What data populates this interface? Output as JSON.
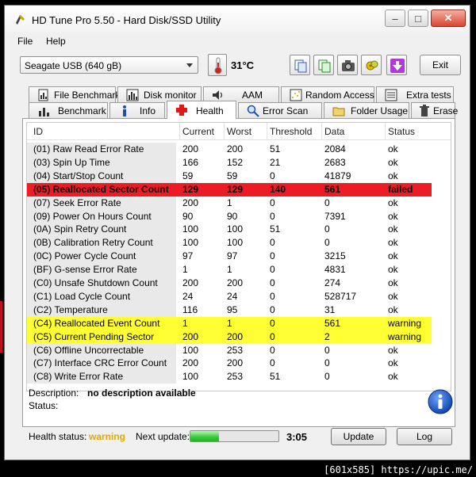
{
  "window": {
    "title": "HD Tune Pro 5.50 - Hard Disk/SSD Utility"
  },
  "menu": {
    "file": "File",
    "help": "Help"
  },
  "toolbar": {
    "drive": "Seagate USB (640 gB)",
    "temperature": "31°C",
    "exit": "Exit"
  },
  "tabs_top": [
    {
      "label": "File Benchmark",
      "icon": "file-benchmark-icon"
    },
    {
      "label": "Disk monitor",
      "icon": "disk-monitor-icon"
    },
    {
      "label": "AAM",
      "icon": "speaker-icon"
    },
    {
      "label": "Random Access",
      "icon": "random-access-icon"
    },
    {
      "label": "Extra tests",
      "icon": "extra-tests-icon"
    }
  ],
  "tabs_bottom": [
    {
      "label": "Benchmark",
      "icon": "benchmark-icon"
    },
    {
      "label": "Info",
      "icon": "info-icon"
    },
    {
      "label": "Health",
      "icon": "health-cross-icon",
      "active": true
    },
    {
      "label": "Error Scan",
      "icon": "magnifier-icon"
    },
    {
      "label": "Folder Usage",
      "icon": "folder-icon"
    },
    {
      "label": "Erase",
      "icon": "trash-icon"
    }
  ],
  "table": {
    "headers": {
      "id": "ID",
      "current": "Current",
      "worst": "Worst",
      "threshold": "Threshold",
      "data": "Data",
      "status": "Status"
    },
    "rows": [
      {
        "id": "(01) Raw Read Error Rate",
        "current": "200",
        "worst": "200",
        "threshold": "51",
        "data": "2084",
        "status": "ok"
      },
      {
        "id": "(03) Spin Up Time",
        "current": "166",
        "worst": "152",
        "threshold": "21",
        "data": "2683",
        "status": "ok"
      },
      {
        "id": "(04) Start/Stop Count",
        "current": "59",
        "worst": "59",
        "threshold": "0",
        "data": "41879",
        "status": "ok"
      },
      {
        "id": "(05) Reallocated Sector Count",
        "current": "129",
        "worst": "129",
        "threshold": "140",
        "data": "561",
        "status": "failed",
        "highlight": "red"
      },
      {
        "id": "(07) Seek Error Rate",
        "current": "200",
        "worst": "1",
        "threshold": "0",
        "data": "0",
        "status": "ok"
      },
      {
        "id": "(09) Power On Hours Count",
        "current": "90",
        "worst": "90",
        "threshold": "0",
        "data": "7391",
        "status": "ok"
      },
      {
        "id": "(0A) Spin Retry Count",
        "current": "100",
        "worst": "100",
        "threshold": "51",
        "data": "0",
        "status": "ok"
      },
      {
        "id": "(0B) Calibration Retry Count",
        "current": "100",
        "worst": "100",
        "threshold": "0",
        "data": "0",
        "status": "ok"
      },
      {
        "id": "(0C) Power Cycle Count",
        "current": "97",
        "worst": "97",
        "threshold": "0",
        "data": "3215",
        "status": "ok"
      },
      {
        "id": "(BF) G-sense Error Rate",
        "current": "1",
        "worst": "1",
        "threshold": "0",
        "data": "4831",
        "status": "ok"
      },
      {
        "id": "(C0) Unsafe Shutdown Count",
        "current": "200",
        "worst": "200",
        "threshold": "0",
        "data": "274",
        "status": "ok"
      },
      {
        "id": "(C1) Load Cycle Count",
        "current": "24",
        "worst": "24",
        "threshold": "0",
        "data": "528717",
        "status": "ok"
      },
      {
        "id": "(C2) Temperature",
        "current": "116",
        "worst": "95",
        "threshold": "0",
        "data": "31",
        "status": "ok"
      },
      {
        "id": "(C4) Reallocated Event Count",
        "current": "1",
        "worst": "1",
        "threshold": "0",
        "data": "561",
        "status": "warning",
        "highlight": "yellow"
      },
      {
        "id": "(C5) Current Pending Sector",
        "current": "200",
        "worst": "200",
        "threshold": "0",
        "data": "2",
        "status": "warning",
        "highlight": "yellow"
      },
      {
        "id": "(C6) Offline Uncorrectable",
        "current": "100",
        "worst": "253",
        "threshold": "0",
        "data": "0",
        "status": "ok"
      },
      {
        "id": "(C7) Interface CRC Error Count",
        "current": "200",
        "worst": "200",
        "threshold": "0",
        "data": "0",
        "status": "ok"
      },
      {
        "id": "(C8) Write Error Rate",
        "current": "100",
        "worst": "253",
        "threshold": "51",
        "data": "0",
        "status": "ok"
      }
    ]
  },
  "description": {
    "label": "Description:",
    "value": "no description available",
    "status_label": "Status:"
  },
  "footer": {
    "health_label": "Health status:",
    "health_value": "warning",
    "next_update_label": "Next update:",
    "progress": 0.32,
    "time": "3:05",
    "update": "Update",
    "log": "Log"
  },
  "watermark": "[601x585] https://upic.me/",
  "colors": {
    "failed": "#ed1c24",
    "warning": "#ffff33",
    "health_warning": "#e0a800"
  }
}
